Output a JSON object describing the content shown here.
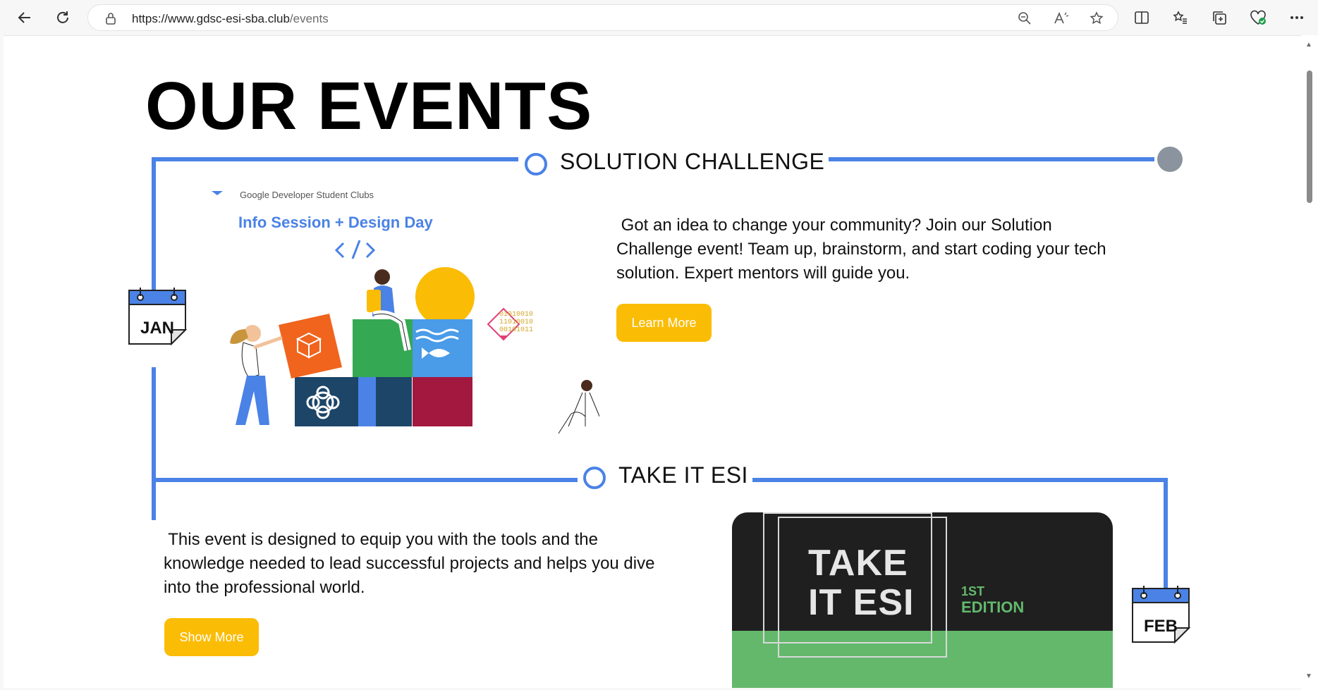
{
  "browser": {
    "url_domain": "https://www.gdsc-esi-sba.club",
    "url_path": "/events"
  },
  "page": {
    "title": "OUR EVENTS"
  },
  "events": [
    {
      "title": "SOLUTION CHALLENGE",
      "description_lines": [
        " Got an idea to change your community? Join our Solution",
        "Challenge event! Team up, brainstorm, and start coding your tech",
        "solution. Expert mentors will guide you."
      ],
      "button_label": "Learn More",
      "month": "JAN",
      "image_header": "Google Developer Student Clubs",
      "image_title": "Info Session + Design Day",
      "image_binary": [
        "01010010",
        "11010010",
        "00101011"
      ]
    },
    {
      "title": "TAKE IT ESI",
      "description_lines": [
        " This event is designed to equip you with the tools and the",
        "knowledge needed to lead successful projects and helps you dive",
        "into the professional world."
      ],
      "button_label": "Show More",
      "month": "FEB",
      "poster_line1": "TAKE",
      "poster_line2": "IT ESI",
      "poster_edition_num": "1ST",
      "poster_edition": "EDITION"
    }
  ],
  "colors": {
    "accent_blue": "#4a82e6",
    "button_yellow": "#fbbc05",
    "poster_green": "#63b86c"
  }
}
